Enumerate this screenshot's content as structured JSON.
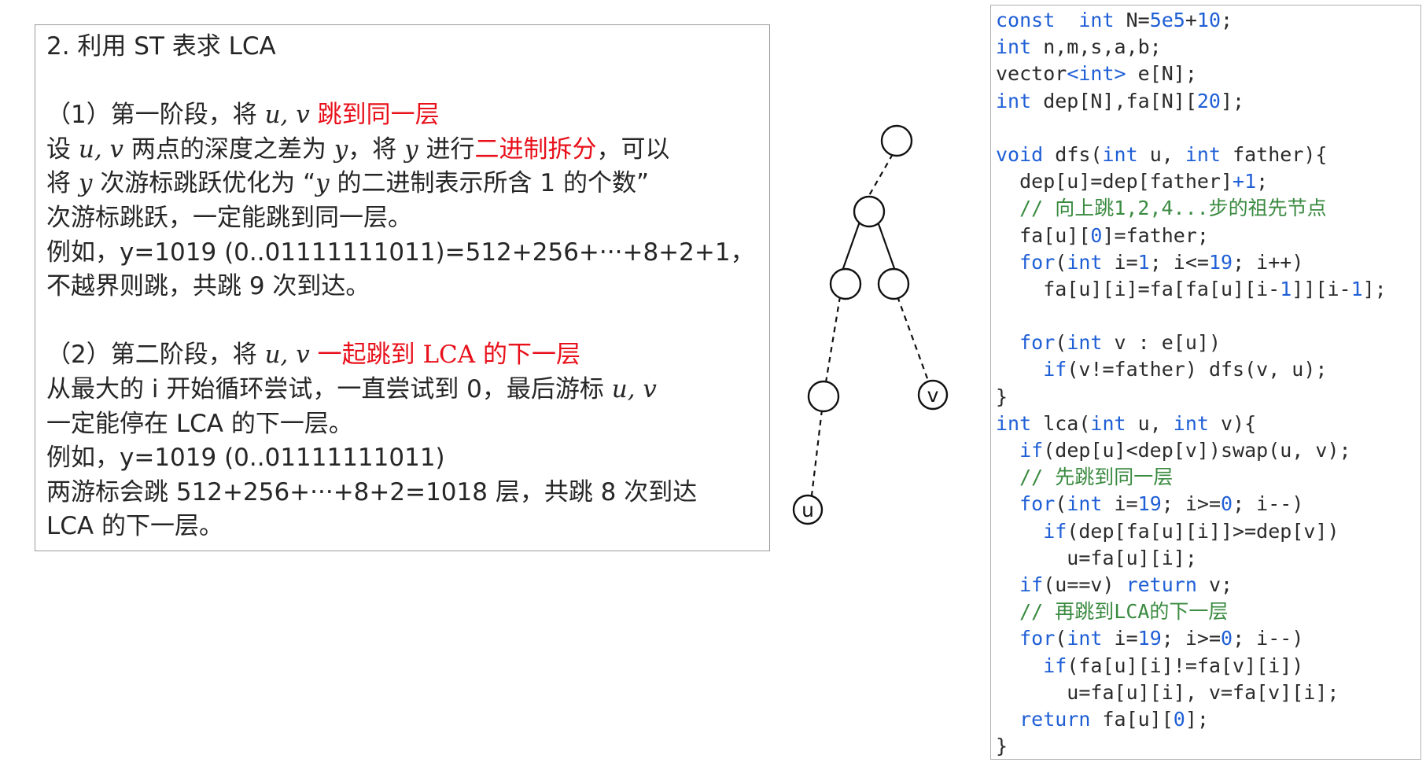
{
  "text_panel": {
    "heading": "2.  利用 ST 表求 LCA",
    "stage1": {
      "title_prefix": "（1）第一阶段，将 ",
      "title_vars": "u, v",
      "title_highlight": " 跳到同一层",
      "l1_a": "设 ",
      "l1_vars": "u, v",
      "l1_b": " 两点的深度之差为 ",
      "l1_y": "y",
      "l1_c": "，将 ",
      "l1_y2": "y",
      "l1_d": " 进行",
      "l1_red": "二进制拆分",
      "l1_e": "，可以",
      "l2_a": "将 ",
      "l2_y": "y",
      "l2_b": " 次游标跳跃优化为 “",
      "l2_y2": "y",
      "l2_c": " 的二进制表示所含 1 的个数”",
      "l3": "次游标跳跃，一定能跳到同一层。",
      "l4": "例如，y=1019 (0..01111111011)=512+256+···+8+2+1，",
      "l5": "不越界则跳，共跳 9 次到达。"
    },
    "stage2": {
      "title_prefix": "（2）第二阶段，将 ",
      "title_vars": "u, v",
      "title_highlight": " 一起跳到 LCA 的下一层",
      "l1_a": "从最大的 i 开始循环尝试，一直尝试到 0，最后游标 ",
      "l1_vars": "u, v",
      "l2": "一定能停在 LCA 的下一层。",
      "l3": "例如，y=1019 (0..01111111011)",
      "l4": "两游标会跳 512+256+···+8+2=1018 层，共跳 8 次到达",
      "l5": "LCA 的下一层。"
    }
  },
  "tree": {
    "label_u": "u",
    "label_v": "v"
  },
  "code": [
    [
      [
        "kw",
        "const"
      ],
      [
        "",
        "  "
      ],
      [
        "kw",
        "int"
      ],
      [
        "",
        " N="
      ],
      [
        "num",
        "5e5"
      ],
      [
        "",
        "+"
      ],
      [
        "num",
        "10"
      ],
      [
        "",
        ";"
      ]
    ],
    [
      [
        "kw",
        "int"
      ],
      [
        "",
        " n,m,s,a,b;"
      ]
    ],
    [
      [
        "",
        "vector"
      ],
      [
        "kw",
        "<int>"
      ],
      [
        "",
        " e[N];"
      ]
    ],
    [
      [
        "kw",
        "int"
      ],
      [
        "",
        " dep[N],fa[N]["
      ],
      [
        "num",
        "20"
      ],
      [
        "",
        "];"
      ]
    ],
    [
      [
        "",
        ""
      ]
    ],
    [
      [
        "kw",
        "void"
      ],
      [
        "",
        " dfs("
      ],
      [
        "kw",
        "int"
      ],
      [
        "",
        " u, "
      ],
      [
        "kw",
        "int"
      ],
      [
        "",
        " father){"
      ]
    ],
    [
      [
        "",
        "  dep[u]=dep[father]"
      ],
      [
        "num",
        "+1"
      ],
      [
        "",
        ";"
      ]
    ],
    [
      [
        "",
        "  "
      ],
      [
        "cm",
        "// 向上跳1,2,4...步的祖先节点"
      ]
    ],
    [
      [
        "",
        "  fa[u]["
      ],
      [
        "num",
        "0"
      ],
      [
        "",
        "]=father;"
      ]
    ],
    [
      [
        "",
        "  "
      ],
      [
        "kw",
        "for"
      ],
      [
        "",
        "("
      ],
      [
        "kw",
        "int"
      ],
      [
        "",
        " i="
      ],
      [
        "num",
        "1"
      ],
      [
        "",
        "; i<="
      ],
      [
        "num",
        "19"
      ],
      [
        "",
        "; i++)"
      ]
    ],
    [
      [
        "",
        "    fa[u][i]=fa[fa[u][i-"
      ],
      [
        "num",
        "1"
      ],
      [
        "",
        "]][i-"
      ],
      [
        "num",
        "1"
      ],
      [
        "",
        "];"
      ]
    ],
    [
      [
        "",
        ""
      ]
    ],
    [
      [
        "",
        "  "
      ],
      [
        "kw",
        "for"
      ],
      [
        "",
        "("
      ],
      [
        "kw",
        "int"
      ],
      [
        "",
        " v : e[u])"
      ]
    ],
    [
      [
        "",
        "    "
      ],
      [
        "kw",
        "if"
      ],
      [
        "",
        "(v!=father) dfs(v, u);"
      ]
    ],
    [
      [
        "",
        "}"
      ]
    ],
    [
      [
        "kw",
        "int"
      ],
      [
        "",
        " lca("
      ],
      [
        "kw",
        "int"
      ],
      [
        "",
        " u, "
      ],
      [
        "kw",
        "int"
      ],
      [
        "",
        " v){"
      ]
    ],
    [
      [
        "",
        "  "
      ],
      [
        "kw",
        "if"
      ],
      [
        "",
        "(dep[u]<dep[v])swap(u, v);"
      ]
    ],
    [
      [
        "",
        "  "
      ],
      [
        "cm",
        "// 先跳到同一层"
      ]
    ],
    [
      [
        "",
        "  "
      ],
      [
        "kw",
        "for"
      ],
      [
        "",
        "("
      ],
      [
        "kw",
        "int"
      ],
      [
        "",
        " i="
      ],
      [
        "num",
        "19"
      ],
      [
        "",
        "; i>="
      ],
      [
        "num",
        "0"
      ],
      [
        "",
        "; i--)"
      ]
    ],
    [
      [
        "",
        "    "
      ],
      [
        "kw",
        "if"
      ],
      [
        "",
        "(dep[fa[u][i]]>=dep[v])"
      ]
    ],
    [
      [
        "",
        "      u=fa[u][i];"
      ]
    ],
    [
      [
        "",
        "  "
      ],
      [
        "kw",
        "if"
      ],
      [
        "",
        "(u==v) "
      ],
      [
        "kw",
        "return"
      ],
      [
        "",
        " v;"
      ]
    ],
    [
      [
        "",
        "  "
      ],
      [
        "cm",
        "// 再跳到LCA的下一层"
      ]
    ],
    [
      [
        "",
        "  "
      ],
      [
        "kw",
        "for"
      ],
      [
        "",
        "("
      ],
      [
        "kw",
        "int"
      ],
      [
        "",
        " i="
      ],
      [
        "num",
        "19"
      ],
      [
        "",
        "; i>="
      ],
      [
        "num",
        "0"
      ],
      [
        "",
        "; i--)"
      ]
    ],
    [
      [
        "",
        "    "
      ],
      [
        "kw",
        "if"
      ],
      [
        "",
        "(fa[u][i]!=fa[v][i])"
      ]
    ],
    [
      [
        "",
        "      u=fa[u][i], v=fa[v][i];"
      ]
    ],
    [
      [
        "",
        "  "
      ],
      [
        "kw",
        "return"
      ],
      [
        "",
        " fa[u]["
      ],
      [
        "num",
        "0"
      ],
      [
        "",
        "];"
      ]
    ],
    [
      [
        "",
        "}"
      ]
    ]
  ]
}
